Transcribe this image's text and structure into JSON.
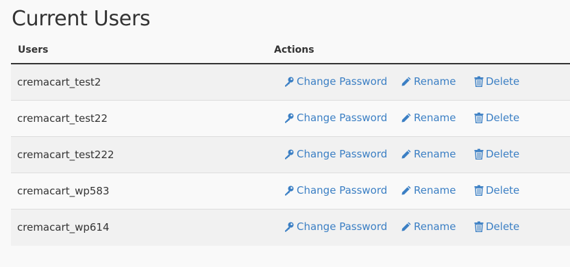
{
  "page": {
    "title": "Current Users"
  },
  "table": {
    "headers": {
      "users": "Users",
      "actions": "Actions"
    },
    "rows": [
      {
        "username": "cremacart_test2"
      },
      {
        "username": "cremacart_test22"
      },
      {
        "username": "cremacart_test222"
      },
      {
        "username": "cremacart_wp583"
      },
      {
        "username": "cremacart_wp614"
      }
    ]
  },
  "actions": {
    "change_password": "Change Password",
    "rename": "Rename",
    "delete": "Delete"
  },
  "icons": {
    "change_password": "key-icon",
    "rename": "pencil-icon",
    "delete": "trash-icon"
  },
  "colors": {
    "link": "#3b7fc4",
    "text": "#333333",
    "row_odd": "#f1f1f1",
    "row_even": "#f9f9f9"
  }
}
